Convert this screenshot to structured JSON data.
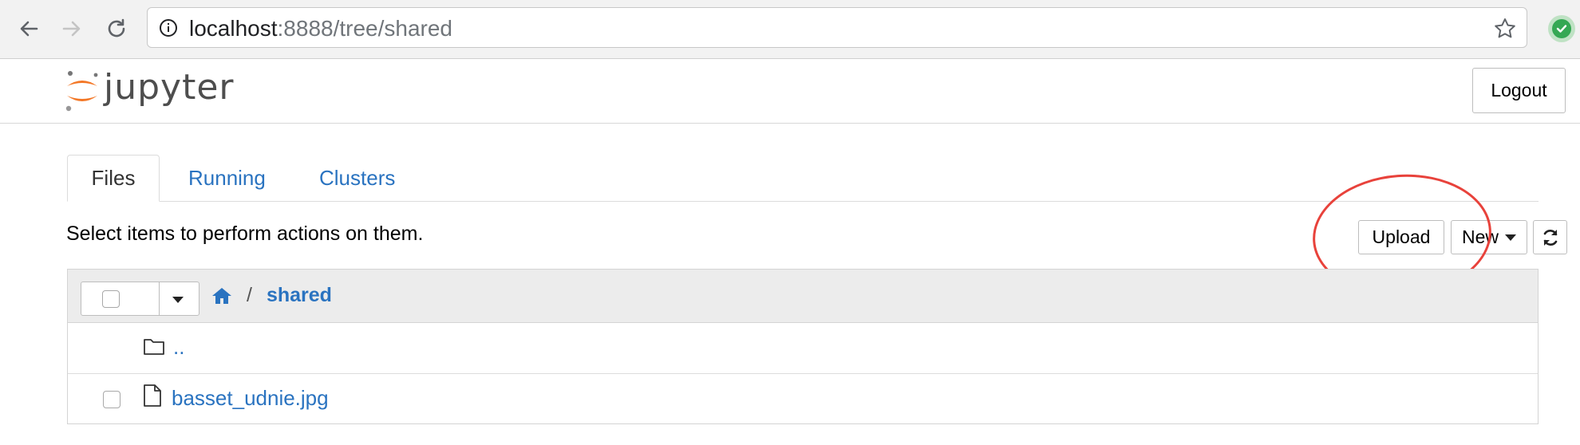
{
  "browser": {
    "url_host": "localhost",
    "url_rest": ":8888/tree/shared"
  },
  "header": {
    "logo_text": "jupyter",
    "logout_label": "Logout"
  },
  "tabs": [
    {
      "label": "Files",
      "active": true
    },
    {
      "label": "Running",
      "active": false
    },
    {
      "label": "Clusters",
      "active": false
    }
  ],
  "toolbar": {
    "hint": "Select items to perform actions on them.",
    "upload_label": "Upload",
    "new_label": "New"
  },
  "breadcrumb": {
    "separator": "/",
    "current": "shared"
  },
  "files": [
    {
      "name": "..",
      "type": "folder"
    },
    {
      "name": "basset_udnie.jpg",
      "type": "file"
    }
  ],
  "colors": {
    "link": "#2a73c0",
    "annotation": "#e8423b",
    "logo_orange": "#f37726"
  }
}
